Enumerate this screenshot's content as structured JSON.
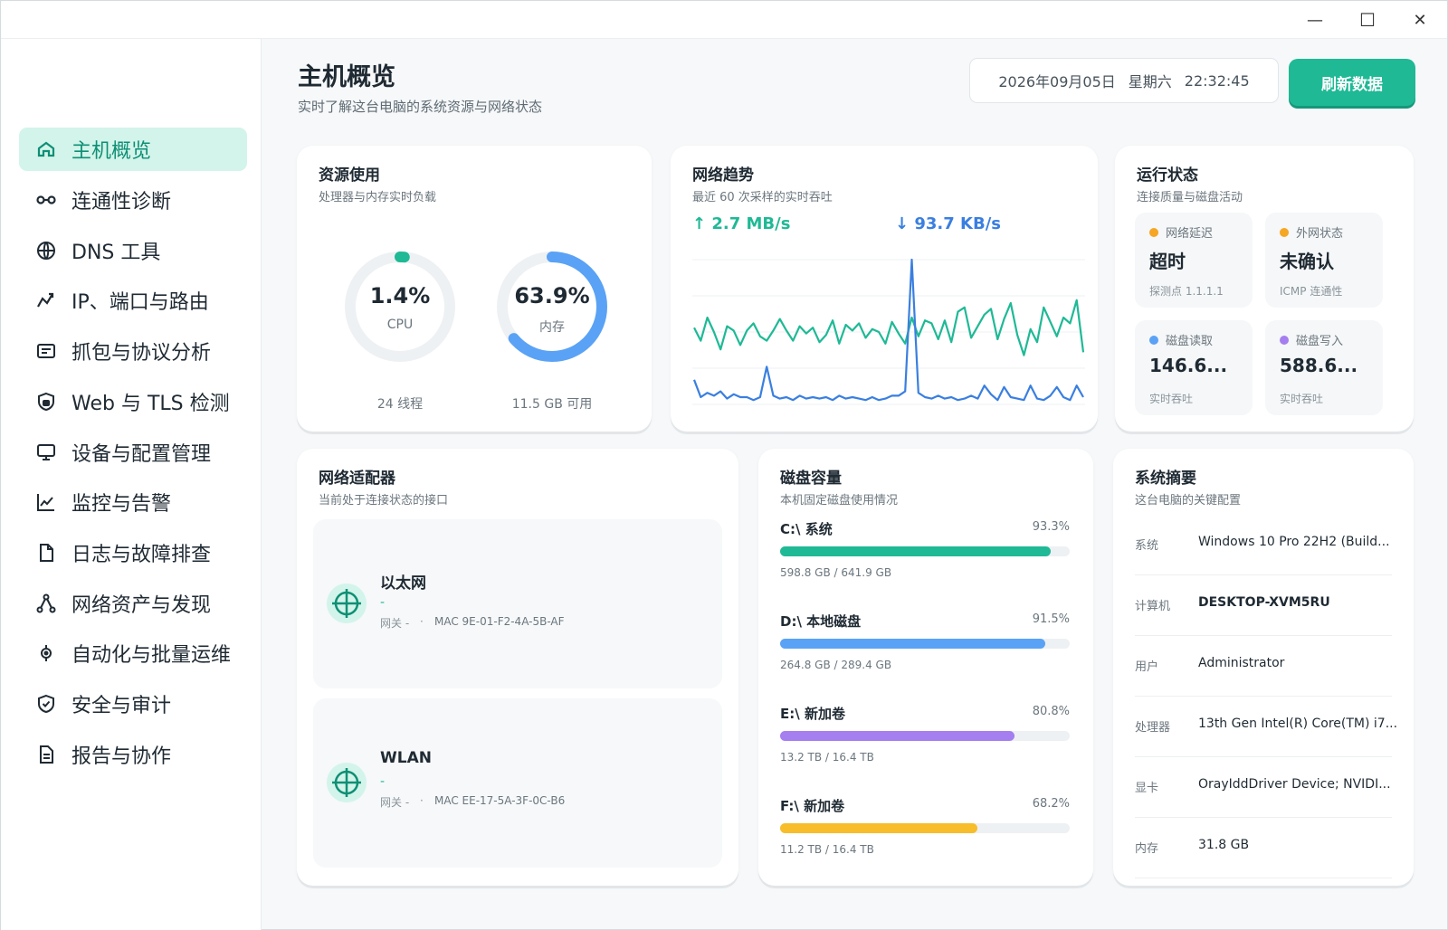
{
  "window": {
    "min": "—",
    "max": "☐",
    "close": "✕"
  },
  "sidebar": {
    "items": [
      {
        "label": "主机概览",
        "icon": "home-icon"
      },
      {
        "label": "连通性诊断",
        "icon": "link-icon"
      },
      {
        "label": "DNS 工具",
        "icon": "globe-icon"
      },
      {
        "label": "IP、端口与路由",
        "icon": "route-icon"
      },
      {
        "label": "抓包与协议分析",
        "icon": "packet-icon"
      },
      {
        "label": "Web 与 TLS 检测",
        "icon": "shield-lock-icon"
      },
      {
        "label": "设备与配置管理",
        "icon": "monitor-icon"
      },
      {
        "label": "监控与告警",
        "icon": "chart-line-icon"
      },
      {
        "label": "日志与故障排查",
        "icon": "file-icon"
      },
      {
        "label": "网络资产与发现",
        "icon": "network-icon"
      },
      {
        "label": "自动化与批量运维",
        "icon": "automation-icon"
      },
      {
        "label": "安全与审计",
        "icon": "shield-check-icon"
      },
      {
        "label": "报告与协作",
        "icon": "document-icon"
      }
    ]
  },
  "header": {
    "title": "主机概览",
    "subtitle": "实时了解这台电脑的系统资源与网络状态",
    "date": "2026年09月05日",
    "weekday": "星期六",
    "time": "22:32:45",
    "refresh": "刷新数据"
  },
  "resource": {
    "title": "资源使用",
    "subtitle": "处理器与内存实时负载",
    "cpu": {
      "value": "1.4%",
      "label": "CPU",
      "footer": "24 线程",
      "percent": 1.4,
      "color": "#1fb995"
    },
    "mem": {
      "value": "63.9%",
      "label": "内存",
      "footer": "11.5 GB 可用",
      "percent": 63.9,
      "color": "#5aa2f5"
    }
  },
  "network": {
    "title": "网络趋势",
    "subtitle": "最近 60 次采样的实时吞吐",
    "up": "↑ 2.7 MB/s",
    "down": "↓ 93.7 KB/s"
  },
  "chart_data": {
    "type": "line",
    "ylim": [
      0,
      100
    ],
    "grid": true,
    "series": [
      {
        "color": "#1fb995",
        "values": [
          53,
          44,
          60,
          50,
          38,
          54,
          51,
          41,
          51,
          56,
          47,
          44,
          51,
          59,
          51,
          44,
          54,
          49,
          53,
          43,
          48,
          58,
          42,
          55,
          51,
          56,
          46,
          52,
          50,
          42,
          57,
          49,
          42,
          60,
          47,
          58,
          56,
          45,
          58,
          43,
          64,
          67,
          46,
          54,
          62,
          66,
          45,
          59,
          70,
          48,
          34,
          52,
          43,
          67,
          57,
          47,
          60,
          56,
          72,
          36
        ]
      },
      {
        "color": "#3a7fe0",
        "values": [
          17,
          5,
          8,
          6,
          9,
          4,
          7,
          5,
          5,
          3,
          5,
          26,
          6,
          4,
          5,
          3,
          6,
          4,
          5,
          4,
          5,
          3,
          6,
          4,
          5,
          4,
          3,
          5,
          3,
          4,
          6,
          6,
          9,
          100,
          8,
          5,
          4,
          6,
          4,
          5,
          3,
          4,
          6,
          4,
          13,
          7,
          3,
          12,
          5,
          4,
          3,
          13,
          4,
          3,
          6,
          12,
          5,
          3,
          13,
          5
        ]
      }
    ]
  },
  "status": {
    "title": "运行状态",
    "subtitle": "连接质量与磁盘活动",
    "tiles": [
      {
        "label": "网络延迟",
        "value": "超时",
        "note": "探测点 1.1.1.1",
        "color": "#f5a623"
      },
      {
        "label": "外网状态",
        "value": "未确认",
        "note": "ICMP 连通性",
        "color": "#f5a623"
      },
      {
        "label": "磁盘读取",
        "value": "146.6...",
        "note": "实时吞吐",
        "color": "#5aa2f5"
      },
      {
        "label": "磁盘写入",
        "value": "588.6...",
        "note": "实时吞吐",
        "color": "#a57ef0"
      }
    ]
  },
  "adapters": {
    "title": "网络适配器",
    "subtitle": "当前处于连接状态的接口",
    "items": [
      {
        "name": "以太网",
        "ip": "-",
        "gateway": "网关 -",
        "sep": "·",
        "mac": "MAC 9E-01-F2-4A-5B-AF"
      },
      {
        "name": "WLAN",
        "ip": "-",
        "gateway": "网关 -",
        "sep": "·",
        "mac": "MAC EE-17-5A-3F-0C-B6"
      }
    ]
  },
  "disks": {
    "title": "磁盘容量",
    "subtitle": "本机固定磁盘使用情况",
    "items": [
      {
        "name": "C:\\ 系统",
        "pct": "93.3%",
        "percent": 93.3,
        "usage": "598.8 GB / 641.9 GB",
        "color": "#1fb995"
      },
      {
        "name": "D:\\ 本地磁盘",
        "pct": "91.5%",
        "percent": 91.5,
        "usage": "264.8 GB / 289.4 GB",
        "color": "#5aa2f5"
      },
      {
        "name": "E:\\ 新加卷",
        "pct": "80.8%",
        "percent": 80.8,
        "usage": "13.2 TB / 16.4 TB",
        "color": "#a57ef0"
      },
      {
        "name": "F:\\ 新加卷",
        "pct": "68.2%",
        "percent": 68.2,
        "usage": "11.2 TB / 16.4 TB",
        "color": "#f7bd2b"
      }
    ]
  },
  "summary": {
    "title": "系统摘要",
    "subtitle": "这台电脑的关键配置",
    "rows": [
      {
        "key": "系统",
        "value": "Windows 10 Pro 22H2 (Build...",
        "bold": false
      },
      {
        "key": "计算机",
        "value": "DESKTOP-XVM5RU",
        "bold": true
      },
      {
        "key": "用户",
        "value": "Administrator",
        "bold": false
      },
      {
        "key": "处理器",
        "value": "13th Gen Intel(R) Core(TM) i7...",
        "bold": false
      },
      {
        "key": "显卡",
        "value": "OrayIddDriver Device; NVIDI...",
        "bold": false
      },
      {
        "key": "内存",
        "value": "31.8 GB",
        "bold": false
      }
    ]
  }
}
